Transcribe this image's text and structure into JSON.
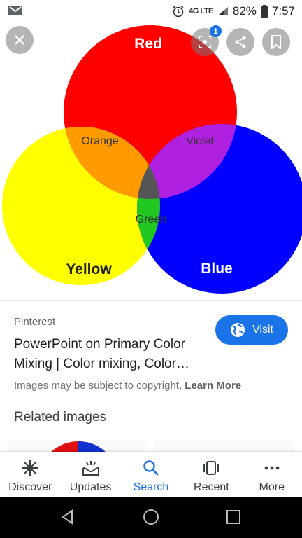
{
  "status_bar": {
    "network": "4G LTE",
    "battery": "82%",
    "time": "7:57"
  },
  "image": {
    "circles": [
      {
        "label": "Red",
        "color": "#ff0000"
      },
      {
        "label": "Yellow",
        "color": "#ffff00"
      },
      {
        "label": "Blue",
        "color": "#0000ff"
      }
    ],
    "overlaps": [
      {
        "label": "Orange",
        "color": "#ff9a00"
      },
      {
        "label": "Violet",
        "color": "#b020e0"
      },
      {
        "label": "Green",
        "color": "#22c722"
      }
    ],
    "center_color": "#555555"
  },
  "overlay": {
    "lens_badge": "1"
  },
  "result": {
    "source": "Pinterest",
    "title": "PowerPoint on Primary Color Mixing | Color mixing, Color…",
    "visit_label": "Visit",
    "copyright_text": "Images may be subject to copyright.",
    "learn_more": "Learn More"
  },
  "related_heading": "Related images",
  "bottom_nav": {
    "items": [
      {
        "label": "Discover",
        "icon": "asterisk-icon"
      },
      {
        "label": "Updates",
        "icon": "updates-icon"
      },
      {
        "label": "Search",
        "icon": "search-icon"
      },
      {
        "label": "Recent",
        "icon": "recent-icon"
      },
      {
        "label": "More",
        "icon": "more-icon"
      }
    ],
    "active": "Search"
  },
  "colors": {
    "accent": "#1a73e8"
  }
}
